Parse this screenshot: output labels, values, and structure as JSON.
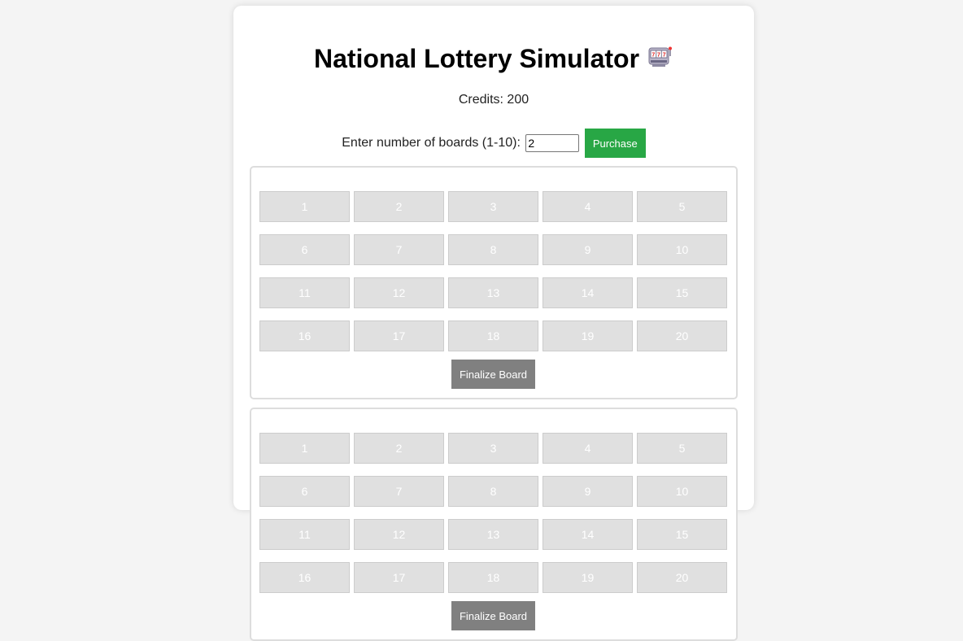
{
  "header": {
    "title": "National Lottery Simulator",
    "icon": "slot-machine-icon"
  },
  "credits_text": "Credits: 200",
  "purchase": {
    "label": "Enter number of boards (1-10):",
    "input_value": "2",
    "button_label": "Purchase"
  },
  "boards": [
    {
      "numbers": [
        "1",
        "2",
        "3",
        "4",
        "5",
        "6",
        "7",
        "8",
        "9",
        "10",
        "11",
        "12",
        "13",
        "14",
        "15",
        "16",
        "17",
        "18",
        "19",
        "20"
      ],
      "finalize_label": "Finalize Board"
    },
    {
      "numbers": [
        "1",
        "2",
        "3",
        "4",
        "5",
        "6",
        "7",
        "8",
        "9",
        "10",
        "11",
        "12",
        "13",
        "14",
        "15",
        "16",
        "17",
        "18",
        "19",
        "20"
      ],
      "finalize_label": "Finalize Board"
    }
  ],
  "colors": {
    "purchase_button": "#28a745",
    "finalize_button": "#808080",
    "number_button": "#e0e0e0",
    "background": "#f4f4f4"
  }
}
